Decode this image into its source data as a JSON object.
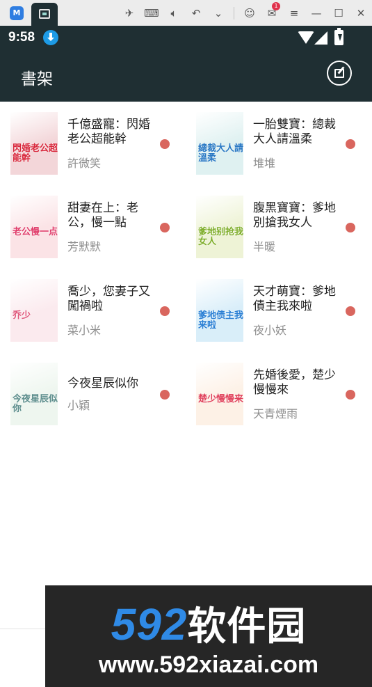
{
  "emulator": {
    "logo": "M",
    "mail_badge": "1",
    "tools": [
      "pin-icon",
      "keyboard-icon",
      "volume-icon",
      "undo-icon",
      "chevron-down-icon",
      "user-icon",
      "mail-icon",
      "menu-icon",
      "minimize-icon",
      "maximize-icon",
      "close-icon"
    ]
  },
  "status_bar": {
    "time": "9:58"
  },
  "app_bar": {
    "title": "書架",
    "background": "#1f2f33"
  },
  "books": [
    {
      "title": "千億盛寵：閃婚老公超能幹",
      "author": "許微笑",
      "cover_text": "閃婚老公超能幹",
      "cover_color": "#f3d6d9",
      "cover_text_color": "#d8283c",
      "unread_color": "#d9665e"
    },
    {
      "title": "一胎雙寶：總裁大人請溫柔",
      "author": "堆堆",
      "cover_text": "總裁大人請溫柔",
      "cover_color": "#dff1f1",
      "cover_text_color": "#2a79c4",
      "unread_color": "#d9665e"
    },
    {
      "title": "甜妻在上：老公，慢一點",
      "author": "芳默默",
      "cover_text": "老公慢一点",
      "cover_color": "#fbe3e6",
      "cover_text_color": "#e03c6a",
      "unread_color": "#d9665e"
    },
    {
      "title": "腹黑寶寶：爹地別搶我女人",
      "author": "半暖",
      "cover_text": "爹地别抢我女人",
      "cover_color": "#eef3d6",
      "cover_text_color": "#7fae2c",
      "unread_color": "#d9665e"
    },
    {
      "title": "喬少，您妻子又闖禍啦",
      "author": "菜小米",
      "cover_text": "乔少",
      "cover_color": "#fbeaee",
      "cover_text_color": "#e0567a",
      "unread_color": "#d9665e"
    },
    {
      "title": "天才萌寶：爹地債主我來啦",
      "author": "夜小妖",
      "cover_text": "爹地债主我来啦",
      "cover_color": "#d9eef9",
      "cover_text_color": "#2a7fd4",
      "unread_color": "#d9665e"
    },
    {
      "title": "今夜星辰似你",
      "author": "小穎",
      "cover_text": "今夜星辰似你",
      "cover_color": "#eef6ef",
      "cover_text_color": "#5a8c8a",
      "unread_color": "#d9665e"
    },
    {
      "title": "先婚後愛，楚少慢慢來",
      "author": "天青煙雨",
      "cover_text": "楚少慢慢来",
      "cover_color": "#fdf1e6",
      "cover_text_color": "#e0405a",
      "unread_color": "#d9665e"
    }
  ],
  "watermark": {
    "number": "592",
    "name": "软件园",
    "url": "www.592xiazai.com"
  }
}
